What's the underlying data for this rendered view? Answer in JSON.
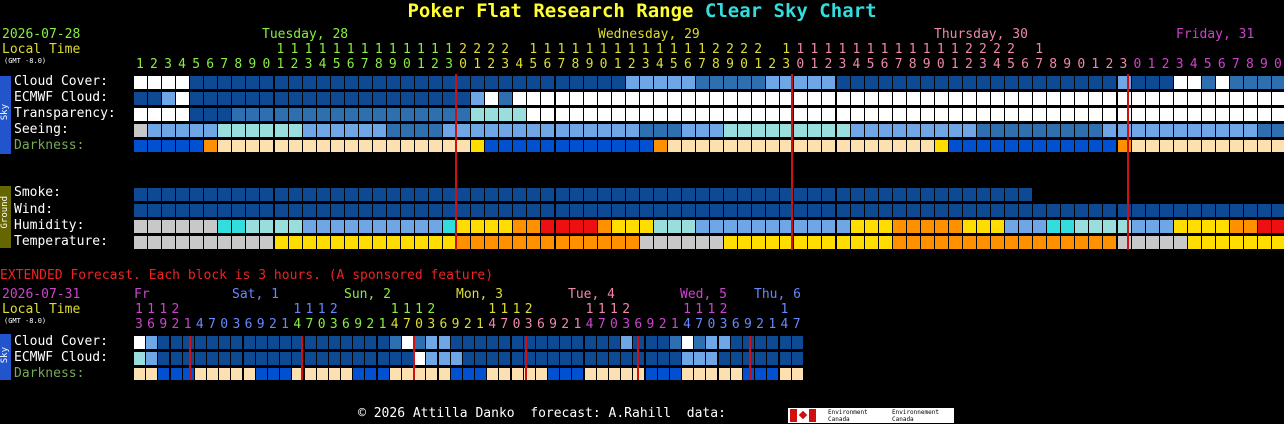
{
  "title": {
    "part1": "Poker Flat Research Range",
    "part2": "Clear Sky Chart"
  },
  "colors": {
    "yellow": "#ffff33",
    "cyan": "#33dddd",
    "green_text": "#88ee44",
    "local_time": "#dddd33",
    "pink": "#ee88aa",
    "magenta": "#cc44cc",
    "blue_text": "#6688ff",
    "red": "#d01010",
    "extended_text": "#ee2222"
  },
  "main": {
    "date": "2026-07-28",
    "local_time": "Local Time",
    "gmt": "(GMT -8.0)",
    "days": [
      {
        "label": "Tuesday, 28"
      },
      {
        "label": "Wednesday, 29"
      },
      {
        "label": "Thursday, 30"
      },
      {
        "label": "Friday, 31"
      }
    ],
    "hour_tens": "          11111111111112222 11111111111112222 11111111111112222 1",
    "hour_ones": "1234567890123456789012301234567890123456789012301234567890123456789012301234567890",
    "sky_rows": [
      {
        "label": "Cloud Cover:"
      },
      {
        "label": "ECMWF Cloud:"
      },
      {
        "label": "Transparency:"
      },
      {
        "label": "Seeing:"
      },
      {
        "label": "Darkness:"
      }
    ],
    "ground_rows": [
      {
        "label": "Smoke:"
      },
      {
        "label": "Wind:"
      },
      {
        "label": "Humidity:"
      },
      {
        "label": "Temperature:"
      }
    ],
    "sidebar_sky": "Sky",
    "sidebar_ground": "Ground"
  },
  "extended": {
    "banner": "EXTENDED Forecast. Each block is 3 hours. (A sponsored feature)",
    "date": "2026-07-31",
    "local_time": "Local Time",
    "gmt": "(GMT -8.0)",
    "days": [
      {
        "label": "Fr"
      },
      {
        "label": "Sat, 1"
      },
      {
        "label": "Sun, 2"
      },
      {
        "label": "Mon, 3"
      },
      {
        "label": "Tue, 4"
      },
      {
        "label": "Wed, 5"
      },
      {
        "label": "Thu, 6"
      }
    ],
    "tens_line": "1112",
    "digits": "369214703692147036921470369214703692147036921470369214703692147",
    "rows": [
      {
        "label": "Cloud Cover:"
      },
      {
        "label": "ECMWF Cloud:"
      },
      {
        "label": "Darkness:"
      }
    ],
    "sidebar": "Sky"
  },
  "footer": {
    "text": "© 2026 Attilla Danko  forecast: A.Rahill  data:",
    "logo_en": "Environment Canada",
    "logo_fr": "Environnement Canada"
  },
  "data": {
    "cloud": "wwwwccccccccccccccccccccccccccccccclllllmmmmmlllllcccccccccccccccccccclcccwwmwmmmmwwwwwwwwwwwwwwwlmmmmmcccclmmmmmmllll",
    "ecmwf": "cclwcccccccccccccccccccclwmwwwwwwwwwwwwwwwwwwwwwwwwwwwwwwwwwwwwwwwwwwwwwwwwwwwwwwwwwwwwwwwgggwwwwgwwwwlllll",
    "transp": "wwwwcccmmmmmmmmmmmmmmmmmttttwwwwwwwwwwwwwwwwwwwwwwwwwwwwwwwwwwwwwwwwwwwwwwwwwwwwwwwwwwwwwwwwwwwwwwwwwwwwwwwwww",
    "seeing": "glllllttttttllllllmmmmllllllllllllllmmmllltttttttttlllllllllmmmmmmmmmlllllllllllmmmllllllllllmmmmmllllllccccccccc",
    "dark": "BBBBBoppppppppppppppppppyBBBBBBBBBBBBopppppppppppppppppppyBBBBBBBBBBBBopppppppppppppppppppyBBBBBBBBBBBBoppppppp",
    "smoke": "ccccccccccccccccccccccccccccccccccccccccccccccccccccccccccccccccccccccccccccccccccccccccccccc",
    "wind": "ccccccccccccccccccccccccccccccccccccccccccccccccccccccccccccccccccccccccccccccccccccccccccccccccccccccccccccccccccc",
    "humid": "ggggggbbttttllllllllllbyyyyoorrrroyyytttlllllllllllyyyoooooyyylllbbttttlllyyyyoorrrrrroryyllllllllyygggg",
    "temp": "ggggggggggyyyyyyyyyyyyyoooooooooooooggggggyyyyyyyyyyyyoooooooooooooooogggggyyyyyyyyyooooooooooogggggyyyyyyy",
    "xcloud": "wlcccccccccccccccccccmwmllcccccccccccccclcccmwmllcccccccccccccccccccccccccccccc",
    "xecmwf": "tlcccccccccccccccccccccwlllcccccccccccccccccclllccccccccccccccllggllcc",
    "xdark": "ppBBBpppppBBBpppppBBBpppppBBBpppppBBBpppppBBBpppppBBBpp"
  }
}
